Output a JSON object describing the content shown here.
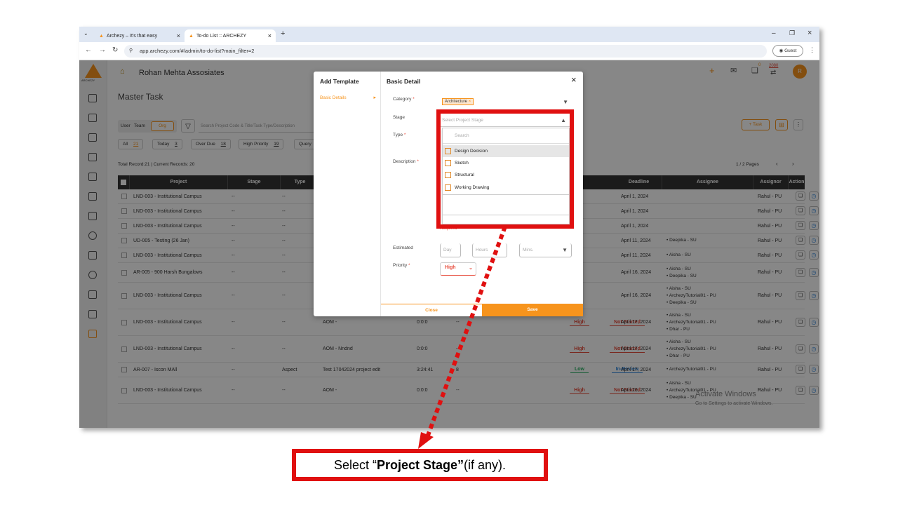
{
  "browser": {
    "tabs": [
      {
        "label": "Archezy – It's that easy"
      },
      {
        "label": "To-do List :: ARCHEZY"
      }
    ],
    "url": "app.archezy.com/#/admin/to-do-list?main_filter=2",
    "guest_label": "Guest"
  },
  "app": {
    "logo_text": "ARCHEZY",
    "company_name": "Rohan Mehta Assosiates",
    "page_title": "Master Task",
    "header_count": "2080",
    "header_badge": "0",
    "avatar_initial": "R",
    "toggle": {
      "user": "User",
      "team": "Team",
      "org": "Org"
    },
    "search_placeholder": "Search Project Code & Title/Task Type/Description",
    "filters": [
      {
        "label": "All",
        "count": "21"
      },
      {
        "label": "Today",
        "count": "3"
      },
      {
        "label": "Over Due",
        "count": "18"
      },
      {
        "label": "High Priority",
        "count": "19"
      },
      {
        "label": "Query",
        "count": ""
      }
    ],
    "task_button": "Task",
    "records_text": "Total Record:21 | Current Records: 20",
    "pages_text": "1 / 2 Pages",
    "watermark_title": "Activate Windows",
    "watermark_sub": "Go to Settings to activate Windows."
  },
  "table": {
    "headers": [
      "Project",
      "Stage",
      "Type",
      "Deadline",
      "Assignee",
      "Assignor",
      "Action"
    ],
    "rows": [
      {
        "project": "LND-003 - Institutional Campus",
        "stage": "--",
        "type": "--",
        "task": "",
        "time": "",
        "dash": "",
        "priority": "",
        "status": "",
        "deadline": "April 1, 2024",
        "assignees": [],
        "assignor": "Rahul - PU"
      },
      {
        "project": "LND-003 - Institutional Campus",
        "stage": "--",
        "type": "--",
        "task": "",
        "time": "",
        "dash": "",
        "priority": "",
        "status": "",
        "deadline": "April 1, 2024",
        "assignees": [],
        "assignor": "Rahul - PU"
      },
      {
        "project": "LND-003 - Institutional Campus",
        "stage": "--",
        "type": "--",
        "task": "",
        "time": "",
        "dash": "",
        "priority": "",
        "status": "",
        "deadline": "April 1, 2024",
        "assignees": [],
        "assignor": "Rahul - PU"
      },
      {
        "project": "UD-005 - Testing (26 Jan)",
        "stage": "--",
        "type": "--",
        "task": "",
        "time": "",
        "dash": "",
        "priority": "",
        "status": "",
        "deadline": "April 11, 2024",
        "assignees": [
          "Deepika - SU"
        ],
        "assignor": "Rahul - PU"
      },
      {
        "project": "LND-003 - Institutional Campus",
        "stage": "--",
        "type": "--",
        "task": "",
        "time": "",
        "dash": "",
        "priority": "",
        "status": "",
        "deadline": "April 11, 2024",
        "assignees": [
          "Aisha - SU"
        ],
        "assignor": "Rahul - PU"
      },
      {
        "project": "AR-005 - 900 Harsh Bungalows",
        "stage": "--",
        "type": "--",
        "task": "",
        "time": "",
        "dash": "",
        "priority": "",
        "status": "",
        "deadline": "April 16, 2024",
        "assignees": [
          "Aisha - SU",
          "Deepika - SU"
        ],
        "assignor": "Rahul - PU"
      },
      {
        "project": "LND-003 - Institutional Campus",
        "stage": "--",
        "type": "--",
        "task": "",
        "time": "",
        "dash": "",
        "priority": "",
        "status": "",
        "deadline": "April 16, 2024",
        "assignees": [
          "Aisha - SU",
          "ArchezyTutorial01 - PU",
          "Deepika - SU"
        ],
        "assignor": "Rahul - PU"
      },
      {
        "project": "LND-003 - Institutional Campus",
        "stage": "--",
        "type": "--",
        "task": "AOM -",
        "time": "0:0:0",
        "dash": "--",
        "priority": "High",
        "status": "Not Started",
        "deadline": "April 17, 2024",
        "assignees": [
          "Aisha - SU",
          "ArchezyTutorial01 - PU",
          "Dhar - PU"
        ],
        "assignor": "Rahul - PU"
      },
      {
        "project": "LND-003 - Institutional Campus",
        "stage": "--",
        "type": "--",
        "task": "AOM - Nndnd",
        "time": "0:0:0",
        "dash": "--",
        "priority": "High",
        "status": "Not Started",
        "deadline": "April 17, 2024",
        "assignees": [
          "Aisha - SU",
          "ArchezyTutorial01 - PU",
          "Dhar - PU"
        ],
        "assignor": "Rahul - PU"
      },
      {
        "project": "AR-007 - Iscon MAll",
        "stage": "--",
        "type": "Aspect",
        "task": "Test 17042024 project edit",
        "time": "3:24:41",
        "dash": "8",
        "priority": "Low",
        "status": "In-Review",
        "deadline": "April 17, 2024",
        "assignees": [
          "ArchezyTutorial01 - PU"
        ],
        "assignor": "Rahul - PU"
      },
      {
        "project": "LND-003 - Institutional Campus",
        "stage": "--",
        "type": "--",
        "task": "AOM -",
        "time": "0:0:0",
        "dash": "--",
        "priority": "High",
        "status": "Not Started",
        "deadline": "April 20, 2024",
        "assignees": [
          "Aisha - SU",
          "ArchezyTutorial01 - PU",
          "Deepika - SU"
        ],
        "assignor": "Rahul - PU"
      }
    ]
  },
  "modal": {
    "left_title": "Add Template",
    "left_item": "Basic Details",
    "right_title": "Basic Detail",
    "close_x": "×",
    "category_label": "Category",
    "category_value": "Architecture",
    "stage_label": "Stage",
    "stage_placeholder": "Select Project Stage",
    "type_label": "Type",
    "description_label": "Description",
    "required_text": "Required",
    "estimated_label": "Estimated",
    "day_placeholder": "Day",
    "hours_placeholder": "Hours",
    "mins_placeholder": "Mins.",
    "priority_label": "Priority",
    "priority_value": "High",
    "close_button": "Close",
    "save_button": "Save",
    "search_placeholder": "Search",
    "stage_options": [
      "Design Decision",
      "Sketch",
      "Structural",
      "Working Drawing"
    ]
  },
  "callout": {
    "prefix": "Select “",
    "bold": "Project Stage”",
    "suffix": " (if any)."
  },
  "colors": {
    "accent": "#f7941d",
    "highlight": "#e01010",
    "high": "#e74c3c",
    "low": "#27ae60",
    "review": "#2e86de"
  }
}
